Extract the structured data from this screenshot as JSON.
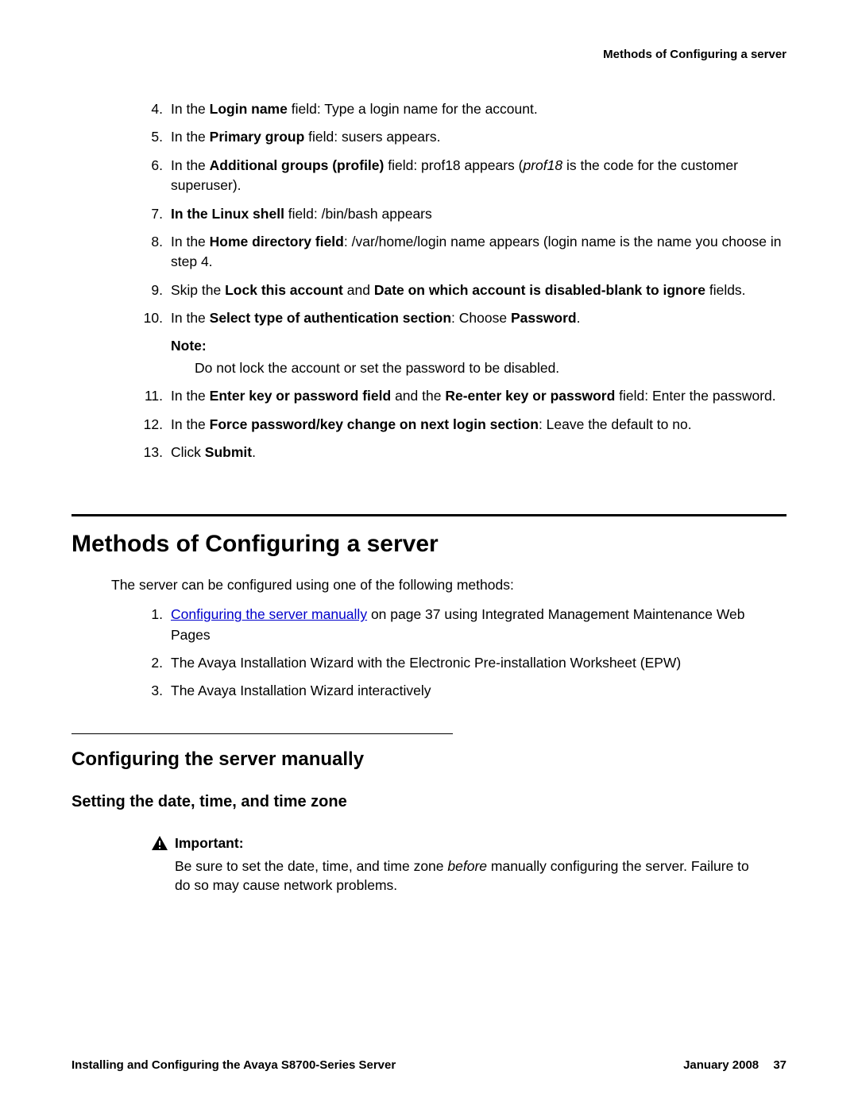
{
  "header": {
    "right": "Methods of Configuring a server"
  },
  "steps": {
    "s4": {
      "num": "4.",
      "pre": "In the ",
      "b1": "Login name",
      "post": " field: Type a login name for the account."
    },
    "s5": {
      "num": "5.",
      "pre": "In the ",
      "b1": "Primary group",
      "post": " field: susers appears."
    },
    "s6": {
      "num": "6.",
      "pre": "In the ",
      "b1": "Additional groups (profile)",
      "mid": " field: prof18 appears (",
      "i1": "prof18",
      "post": " is the code for the customer superuser)."
    },
    "s7": {
      "num": "7.",
      "b1": "In the Linux shell",
      "post": " field: /bin/bash appears"
    },
    "s8": {
      "num": "8.",
      "pre": "In the ",
      "b1": "Home directory field",
      "post": ": /var/home/login name appears (login name is the name you choose in step 4."
    },
    "s9": {
      "num": "9.",
      "pre": "Skip the ",
      "b1": "Lock this account",
      "mid": " and ",
      "b2": "Date on which account is disabled-blank to ignore",
      "post": " fields."
    },
    "s10": {
      "num": "10.",
      "pre": "In the ",
      "b1": "Select type of authentication section",
      "mid": ": Choose ",
      "b2": "Password",
      "post": "."
    },
    "note": {
      "label": "Note:",
      "text": "Do not lock the account or set the password to be disabled."
    },
    "s11": {
      "num": "11.",
      "pre": "In the ",
      "b1": "Enter key or password field",
      "mid": " and the ",
      "b2": "Re-enter key or password",
      "post": " field: Enter the password."
    },
    "s12": {
      "num": "12.",
      "pre": "In the ",
      "b1": "Force password/key change on next login section",
      "post": ": Leave the default to no."
    },
    "s13": {
      "num": "13.",
      "pre": "Click ",
      "b1": "Submit",
      "post": "."
    }
  },
  "section": {
    "h1": "Methods of Configuring a server",
    "intro": "The server can be configured using one of the following methods:",
    "m1": {
      "num": "1.",
      "link": "Configuring the server manually",
      "post": " on page 37 using Integrated Management Maintenance Web Pages"
    },
    "m2": {
      "num": "2.",
      "text": "The Avaya Installation Wizard with the Electronic Pre-installation Worksheet (EPW)"
    },
    "m3": {
      "num": "3.",
      "text": "The Avaya Installation Wizard interactively"
    },
    "h2": "Configuring the server manually",
    "h3": "Setting the date, time, and time zone",
    "important": {
      "label": "Important:",
      "pre": "Be sure to set the date, time, and time zone ",
      "i1": "before",
      "post": " manually configuring the server. Failure to do so may cause network problems."
    }
  },
  "footer": {
    "left": "Installing and Configuring the Avaya S8700-Series Server",
    "date": "January 2008",
    "page": "37"
  }
}
